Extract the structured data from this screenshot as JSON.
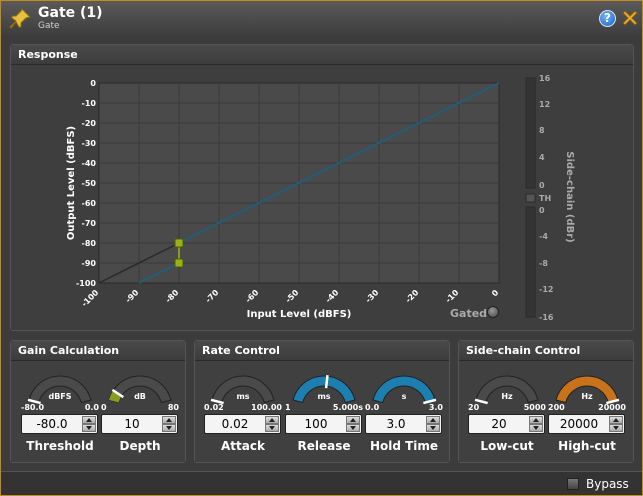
{
  "window": {
    "title": "Gate (1)",
    "subtitle": "Gate"
  },
  "icons": {
    "app": "pushpin-icon",
    "help": "help-icon",
    "close": "close-icon"
  },
  "help_label": "?",
  "response": {
    "header": "Response",
    "gated_label": "Gated",
    "meter_th_label": "TH",
    "meter_ticks": [
      "16",
      "12",
      "8",
      "4",
      "0",
      "0",
      "-4",
      "-8",
      "-12",
      "-16"
    ]
  },
  "chart_data": {
    "type": "line",
    "xlabel": "Input Level (dBFS)",
    "ylabel": "Output Level (dBFS)",
    "y2label": "Side-chain (dBr)",
    "xlim": [
      -100,
      0
    ],
    "ylim": [
      -100,
      0
    ],
    "x_ticks": [
      "-100",
      "-90",
      "-80",
      "-70",
      "-60",
      "-50",
      "-40",
      "-30",
      "-20",
      "-10",
      "0"
    ],
    "y_ticks": [
      "0",
      "-10",
      "-20",
      "-30",
      "-40",
      "-50",
      "-60",
      "-70",
      "-80",
      "-90",
      "-100"
    ],
    "grid": true,
    "series": [
      {
        "points": [
          [
            -100,
            -100
          ],
          [
            -80,
            -80
          ],
          [
            0,
            0
          ]
        ],
        "color": "#2a2a2a"
      },
      {
        "points": [
          [
            -80,
            -90
          ],
          [
            -90,
            -100
          ]
        ],
        "color": "#1f5f7a"
      },
      {
        "points": [
          [
            -80,
            -80
          ],
          [
            0,
            0
          ]
        ],
        "color": "#1f5f7a"
      }
    ],
    "threshold_handle": [
      -80,
      -80
    ],
    "depth_handle": [
      -80,
      -90
    ]
  },
  "sections": {
    "gain": {
      "header": "Gain Calculation"
    },
    "rate": {
      "header": "Rate Control"
    },
    "sidechain": {
      "header": "Side-chain Control"
    }
  },
  "knobs": {
    "threshold": {
      "label": "Threshold",
      "unit": "dBFS",
      "min": "-80.0",
      "max": "0.0",
      "value": "-80.0",
      "level": 0.0,
      "color": "#4a4a4a"
    },
    "depth": {
      "label": "Depth",
      "unit": "dB",
      "min": "0",
      "max": "80",
      "value": "10",
      "level": 0.125,
      "color": "#4a4a4a"
    },
    "attack": {
      "label": "Attack",
      "unit": "ms",
      "min": "0.02",
      "max": "100.00",
      "value": "0.02",
      "level": 0.0,
      "color": "#4a4a4a"
    },
    "release": {
      "label": "Release",
      "unit": "ms",
      "min": "1",
      "max": "5.000s",
      "value": "100",
      "level": 0.54,
      "color": "#1c7fb0"
    },
    "hold": {
      "label": "Hold Time",
      "unit": "s",
      "min": "0.0",
      "max": "3.0",
      "value": "3.0",
      "level": 1.0,
      "color": "#1c7fb0"
    },
    "lowcut": {
      "label": "Low-cut",
      "unit": "Hz",
      "min": "20",
      "max": "5000",
      "value": "20",
      "level": 0.0,
      "color": "#4a4a4a"
    },
    "highcut": {
      "label": "High-cut",
      "unit": "Hz",
      "min": "200",
      "max": "20000",
      "value": "20000",
      "level": 1.0,
      "color": "#c8731c"
    }
  },
  "bypass": {
    "label": "Bypass",
    "checked": false
  }
}
